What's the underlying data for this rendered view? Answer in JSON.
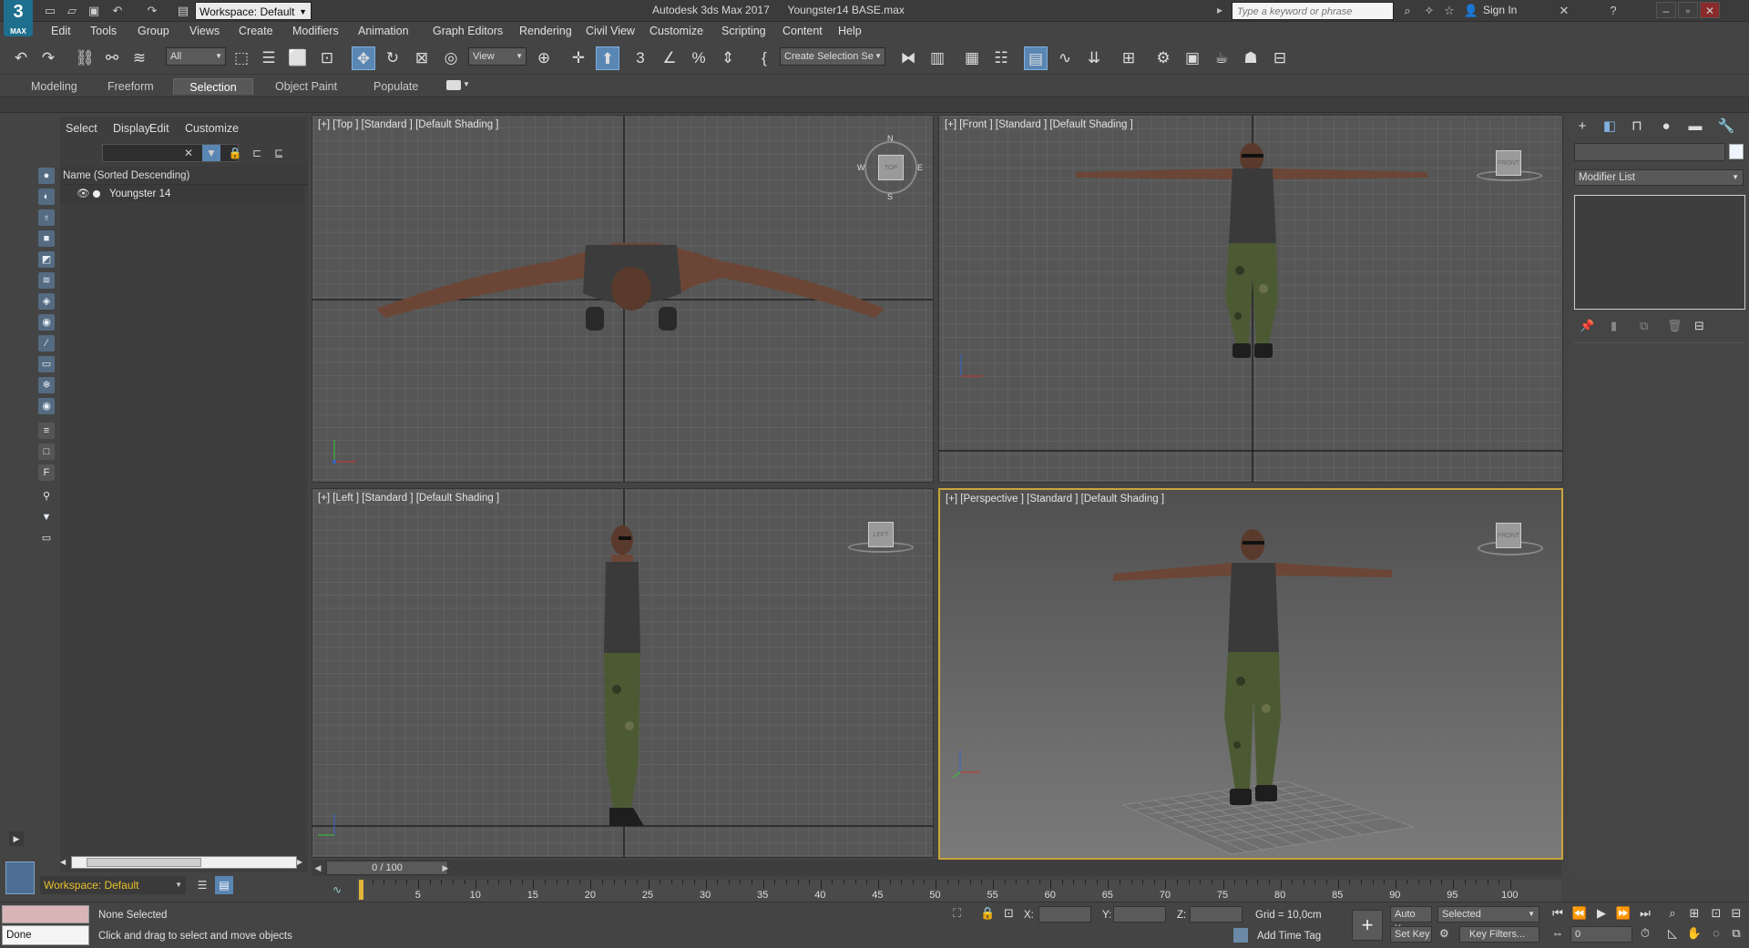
{
  "titlebar": {
    "app_title": "Autodesk 3ds Max 2017",
    "file_name": "Youngster14 BASE.max",
    "workspace": "Workspace: Default",
    "search_placeholder": "Type a keyword or phrase",
    "sign_in": "Sign In",
    "logo_text": "3",
    "logo_sub": "MAX"
  },
  "menu": [
    "Edit",
    "Tools",
    "Group",
    "Views",
    "Create",
    "Modifiers",
    "Animation",
    "Graph Editors",
    "Rendering",
    "Civil View",
    "Customize",
    "Scripting",
    "Content",
    "Help"
  ],
  "toolbar": {
    "filter_value": "All",
    "ref_coord_value": "View",
    "selection_set_value": "Create Selection Se",
    "icons": [
      "undo-icon",
      "redo-icon",
      "link-icon",
      "unlink-icon",
      "bind-space-warp-icon",
      "select-object-icon",
      "select-by-name-icon",
      "rect-region-icon",
      "window-crossing-icon",
      "move-icon",
      "rotate-icon",
      "scale-icon",
      "place-icon",
      "pivot-icon",
      "snap-icon",
      "angle-snap-icon",
      "percent-snap-icon",
      "spinner-snap-icon",
      "edit-named-sets-icon",
      "mirror-icon",
      "align-icon",
      "layer-explorer-icon",
      "toggle-ribbon-icon",
      "scene-explorer-icon",
      "curve-editor-icon",
      "dope-sheet-icon",
      "material-editor-icon",
      "render-setup-icon",
      "render-frame-icon",
      "render-production-icon",
      "render-iterative-icon",
      "arnold-icon"
    ]
  },
  "ribbon": {
    "tabs": [
      "Modeling",
      "Freeform",
      "Selection",
      "Object Paint",
      "Populate"
    ],
    "selected": "Selection"
  },
  "explorer": {
    "menus": [
      "Select",
      "Display",
      "Edit",
      "Customize"
    ],
    "column_header": "Name (Sorted Descending)",
    "rows": [
      {
        "label": "Youngster 14"
      }
    ],
    "workspace": "Workspace: Default"
  },
  "viewports": [
    {
      "label": "[+] [Top ] [Standard ] [Default Shading ]",
      "cube": "TOP"
    },
    {
      "label": "[+] [Front ] [Standard ] [Default Shading ]",
      "cube": "FRONT"
    },
    {
      "label": "[+] [Left ] [Standard ] [Default Shading ]",
      "cube": "LEFT"
    },
    {
      "label": "[+] [Perspective ] [Standard ] [Default Shading ]",
      "cube": "FRONT"
    }
  ],
  "compass": {
    "n": "N",
    "s": "S",
    "e": "E",
    "w": "W"
  },
  "command_panel": {
    "modifier_list": "Modifier List",
    "tabs": [
      "create-icon",
      "modify-icon",
      "hierarchy-icon",
      "motion-icon",
      "display-icon",
      "utilities-icon"
    ]
  },
  "timeline": {
    "frame_display": "0 / 100",
    "ticks": [
      "5",
      "10",
      "15",
      "20",
      "25",
      "30",
      "35",
      "40",
      "45",
      "50",
      "55",
      "60",
      "65",
      "70",
      "75",
      "80",
      "85",
      "90",
      "95",
      "100"
    ]
  },
  "status": {
    "done_label": "Done",
    "selection": "None Selected",
    "prompt": "Click and drag to select and move objects",
    "x_label": "X:",
    "y_label": "Y:",
    "z_label": "Z:",
    "grid": "Grid = 10,0cm",
    "add_time_tag": "Add Time Tag",
    "auto_key": "Auto Key",
    "set_key": "Set Key",
    "key_mode": "Selected",
    "key_filters": "Key Filters...",
    "current_frame": "0"
  },
  "colors": {
    "accent": "#5a86b4",
    "active_viewport": "#c9a53a",
    "background": "#444444"
  }
}
